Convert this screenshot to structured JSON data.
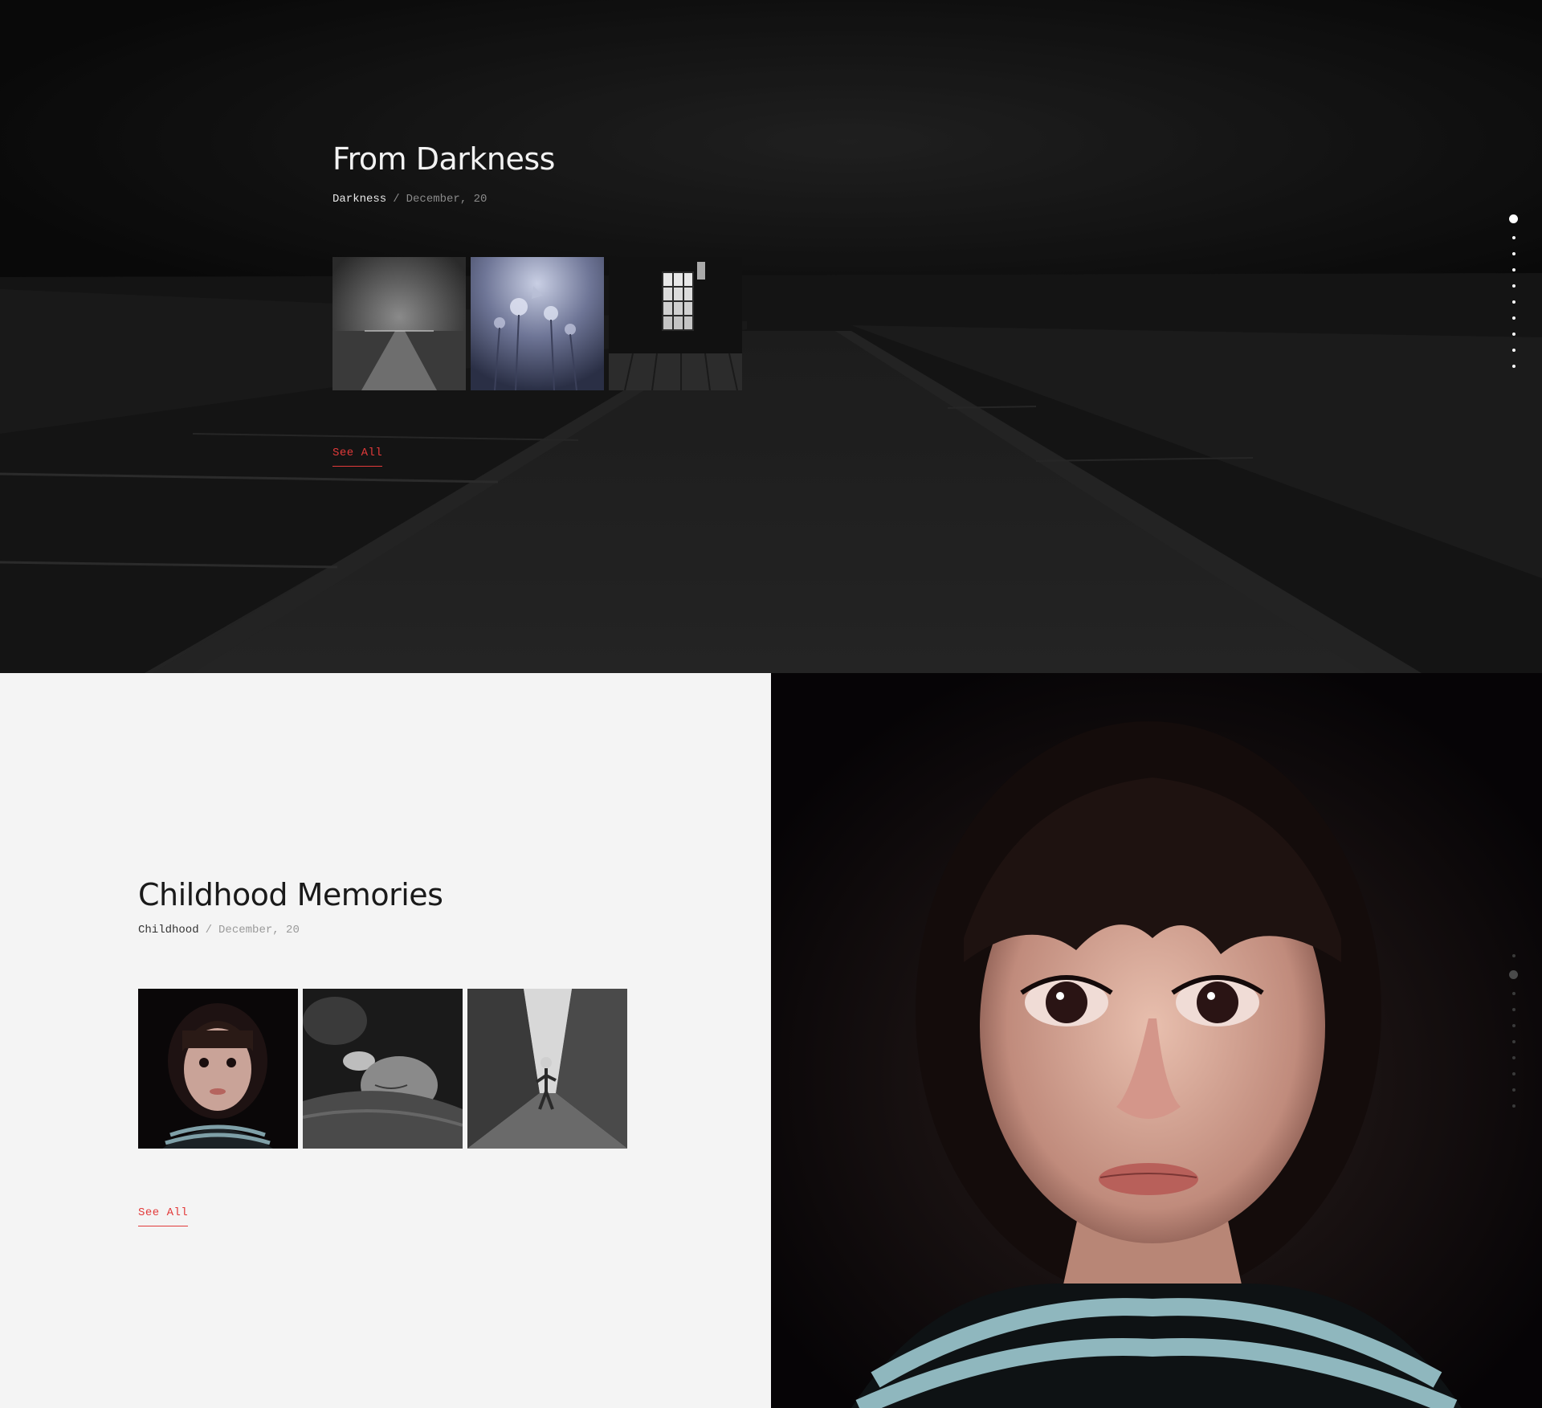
{
  "sections": [
    {
      "title": "From Darkness",
      "category": "Darkness",
      "separator": "/",
      "date": "December, 20",
      "thumbnails": [
        "misty-road-thumbnail",
        "dandelion-thumbnail",
        "dark-window-thumbnail"
      ],
      "see_all_label": "See All"
    },
    {
      "title": "Childhood Memories",
      "category": "Childhood",
      "separator": "/",
      "date": "December, 20",
      "thumbnails": [
        "girl-portrait-thumbnail",
        "sleeping-child-thumbnail",
        "running-child-thumbnail"
      ],
      "see_all_label": "See All"
    }
  ],
  "dot_navigation": {
    "count": 10,
    "active_index_section_1": 0,
    "active_index_section_2": 1
  },
  "colors": {
    "accent": "#e23a3a",
    "dark_bg": "#111111",
    "light_bg": "#f4f4f4",
    "dot_light": "#ffffff",
    "dot_muted": "#3a3a3a"
  }
}
